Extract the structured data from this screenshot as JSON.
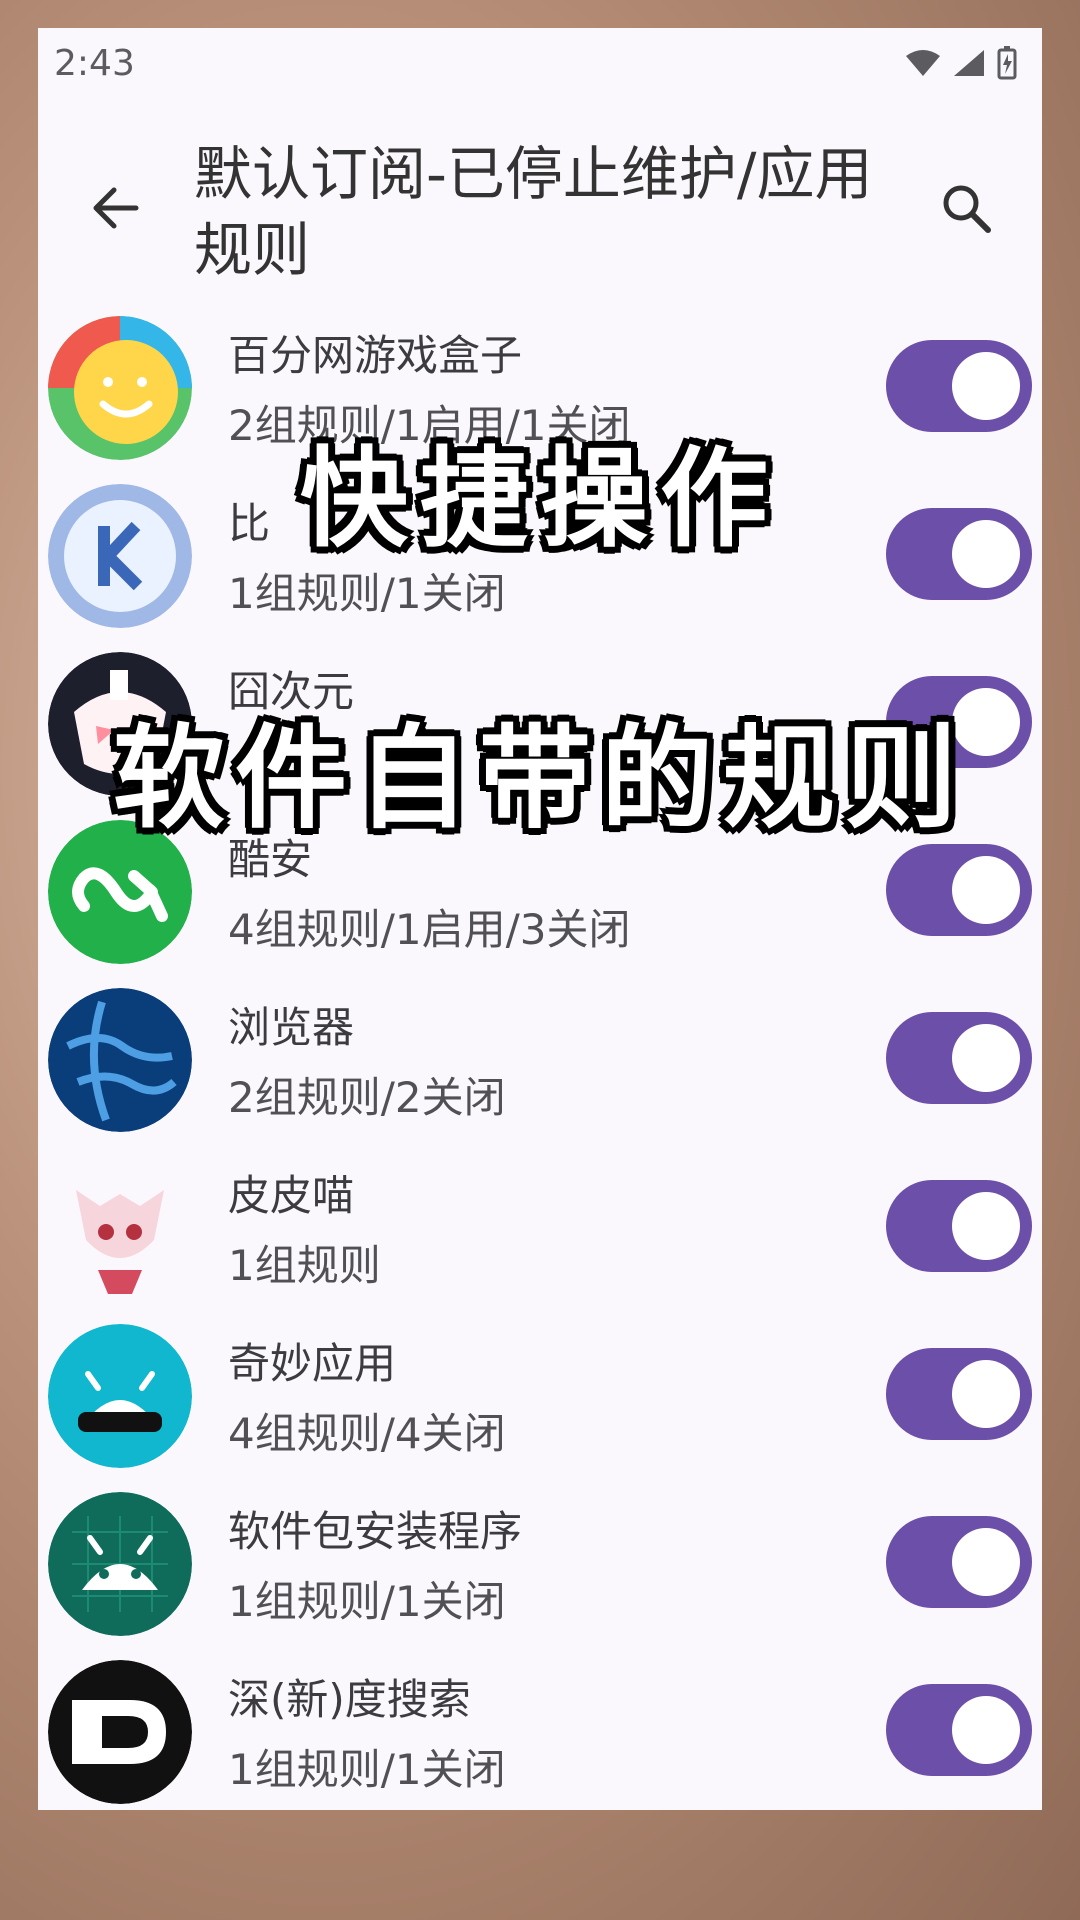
{
  "status_bar": {
    "time": "2:43"
  },
  "header": {
    "title": "默认订阅-已停止维护/应用规则"
  },
  "apps": [
    {
      "name": "百分网游戏盒子",
      "rules": "2组规则/1启用/1关闭",
      "icon": "smiley-face-icon",
      "enabled": true,
      "colors": [
        "#ffd54a",
        "#f05a4e",
        "#35b6e8",
        "#59c36a"
      ]
    },
    {
      "name": "比",
      "rules": "1组规则/1关闭",
      "icon": "k-letter-icon",
      "enabled": true,
      "colors": [
        "#3b67b9",
        "#eaf1ff"
      ]
    },
    {
      "name": "囧次元",
      "rules": "",
      "icon": "anime-face-icon",
      "enabled": true,
      "colors": [
        "#1e1f2d",
        "#ff8f9f"
      ]
    },
    {
      "name": "酷安",
      "rules": "4组规则/1启用/3关闭",
      "icon": "coolapk-icon",
      "enabled": true,
      "colors": [
        "#21b04a",
        "#ffffff"
      ]
    },
    {
      "name": "浏览器",
      "rules": "2组规则/2关闭",
      "icon": "globe-icon",
      "enabled": true,
      "colors": [
        "#0a3e7a",
        "#5fb7ff"
      ]
    },
    {
      "name": "皮皮喵",
      "rules": "1组规则",
      "icon": "anime-cat-icon",
      "enabled": true,
      "colors": [
        "#f7d5dc",
        "#d44b5f"
      ]
    },
    {
      "name": "奇妙应用",
      "rules": "4组规则/4关闭",
      "icon": "magic-android-icon",
      "enabled": true,
      "colors": [
        "#11b6cf",
        "#ffffff",
        "#111111"
      ]
    },
    {
      "name": "软件包安装程序",
      "rules": "1组规则/1关闭",
      "icon": "android-installer-icon",
      "enabled": true,
      "colors": [
        "#0f6b5a",
        "#ffffff"
      ]
    },
    {
      "name": "深(新)度搜索",
      "rules": "1组规则/1关闭",
      "icon": "deep-search-icon",
      "enabled": true,
      "colors": [
        "#111111",
        "#ffffff"
      ]
    }
  ],
  "overlay": {
    "line1": "快捷操作",
    "line2": "软件自带的规则"
  },
  "theme": {
    "accent": "#6b4fa8",
    "background": "#fbf8fd"
  }
}
